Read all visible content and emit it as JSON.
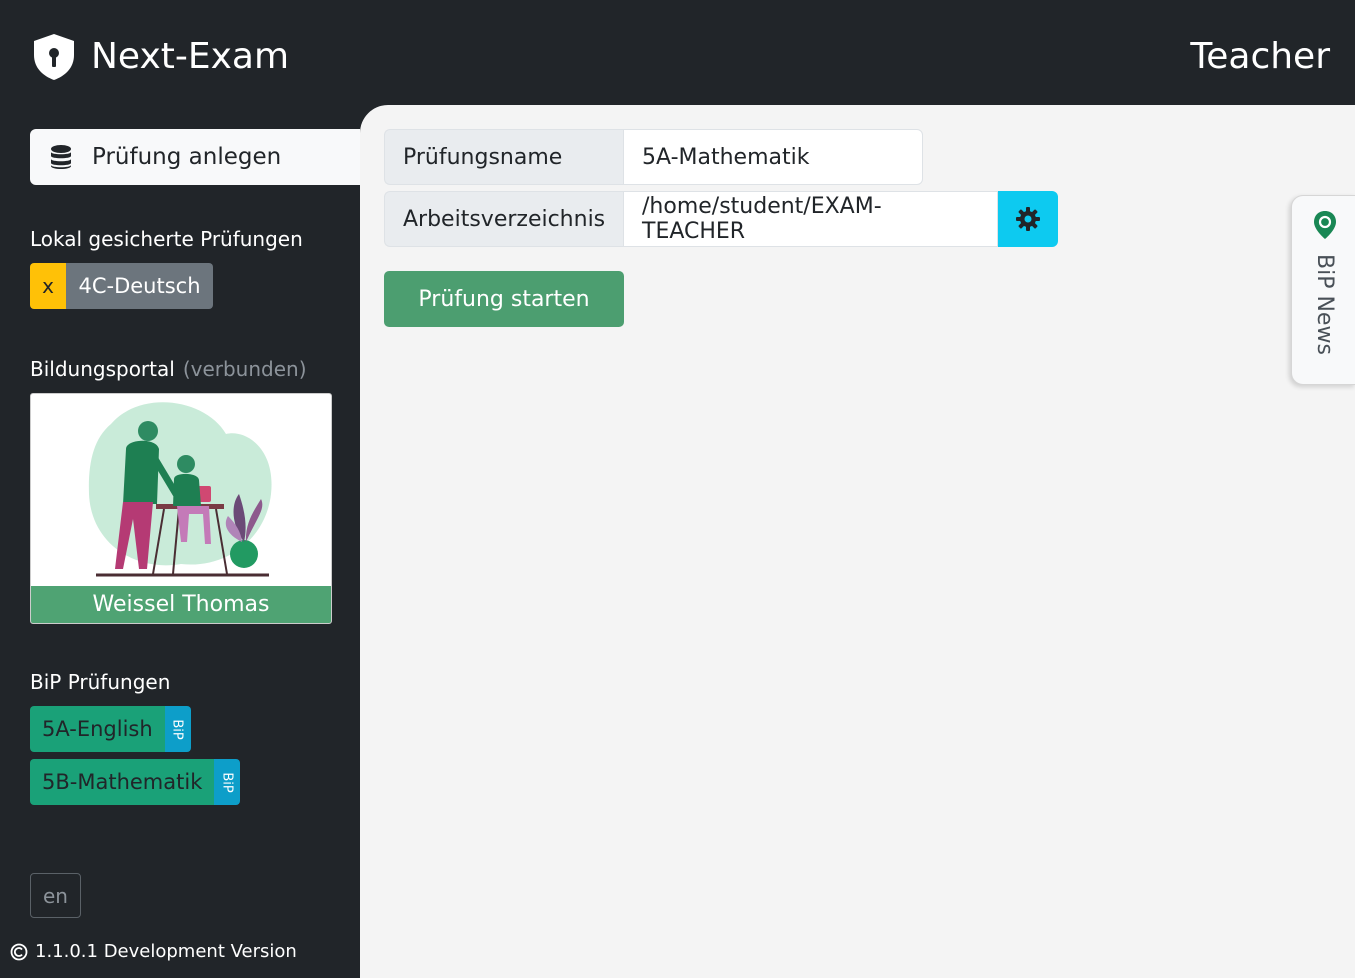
{
  "header": {
    "app_title": "Next-Exam",
    "role": "Teacher"
  },
  "sidebar": {
    "create_exam_label": "Prüfung anlegen",
    "local_exams_title": "Lokal gesicherte Prüfungen",
    "local_exams": [
      {
        "delete_label": "x",
        "name": "4C-Deutsch"
      }
    ],
    "portal_title": "Bildungsportal",
    "portal_status": "(verbunden)",
    "profile_name": "Weissel Thomas",
    "bip_exams_title": "BiP Prüfungen",
    "bip_exams": [
      {
        "name": "5A-English",
        "tag": "BiP"
      },
      {
        "name": "5B-Mathematik",
        "tag": "BiP"
      }
    ],
    "language": "en",
    "version": "1.1.0.1 Development Version"
  },
  "main": {
    "exam_name_label": "Prüfungsname",
    "exam_name_value": "5A-Mathematik",
    "workdir_label": "Arbeitsverzeichnis",
    "workdir_value": "/home/student/EXAM-TEACHER",
    "start_button": "Prüfung starten",
    "news_tab": "BiP News"
  },
  "colors": {
    "background_dark": "#212529",
    "panel": "#f4f4f4",
    "start_green": "#4c9e70",
    "bip_green": "#1aa178",
    "bip_blue": "#0d9ec9",
    "delete_yellow": "#ffc107",
    "settings_cyan": "#0dcaf0"
  },
  "icons": {
    "logo": "shield-keyhole-icon",
    "create_exam": "database-icon",
    "settings": "gear-icon",
    "news": "map-pin-icon",
    "version": "copyright-icon"
  }
}
